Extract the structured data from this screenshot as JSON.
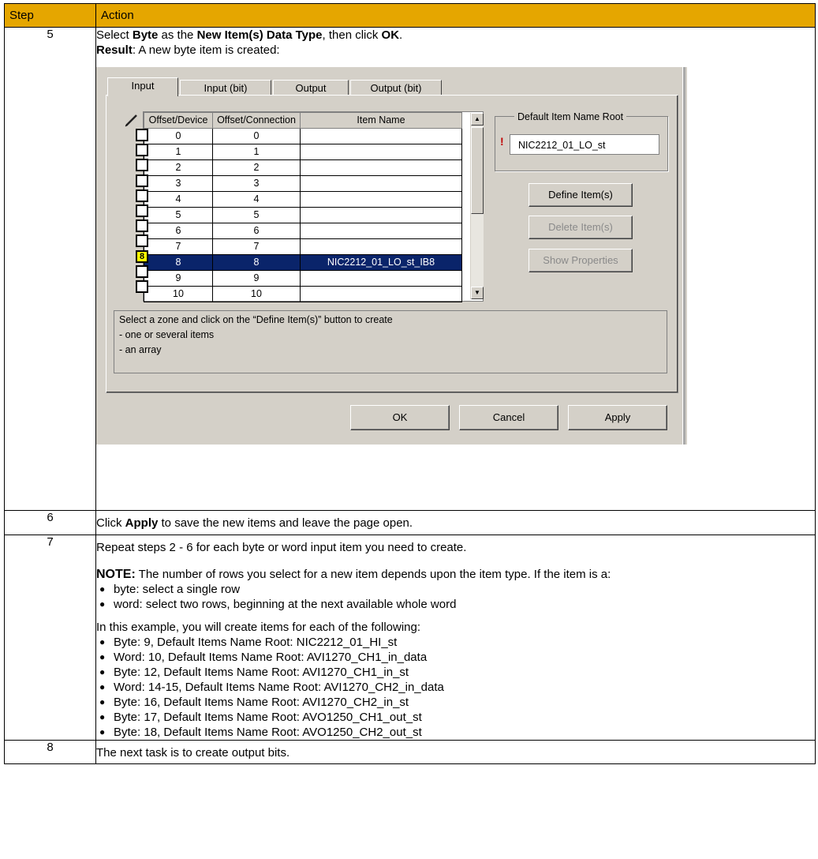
{
  "table": {
    "header_step": "Step",
    "header_action": "Action"
  },
  "step5": {
    "number": "5",
    "line1_pre": "Select ",
    "line1_b1": "Byte",
    "line1_mid1": " as the ",
    "line1_b2": "New Item(s) Data Type",
    "line1_mid2": ", then click ",
    "line1_b3": "OK",
    "line1_end": ".",
    "line2_b": "Result",
    "line2_rest": ": A new byte item is created:"
  },
  "dialog": {
    "tabs": [
      "Input",
      "Input (bit)",
      "Output",
      "Output (bit)"
    ],
    "columns": [
      "Offset/Device",
      "Offset/Connection",
      "Item Name"
    ],
    "rows": [
      {
        "device": "0",
        "connection": "0",
        "item": ""
      },
      {
        "device": "1",
        "connection": "1",
        "item": ""
      },
      {
        "device": "2",
        "connection": "2",
        "item": ""
      },
      {
        "device": "3",
        "connection": "3",
        "item": ""
      },
      {
        "device": "4",
        "connection": "4",
        "item": ""
      },
      {
        "device": "5",
        "connection": "5",
        "item": ""
      },
      {
        "device": "6",
        "connection": "6",
        "item": ""
      },
      {
        "device": "7",
        "connection": "7",
        "item": ""
      },
      {
        "device": "8",
        "connection": "8",
        "item": "NIC2212_01_LO_st_IB8"
      },
      {
        "device": "9",
        "connection": "9",
        "item": ""
      },
      {
        "device": "10",
        "connection": "10",
        "item": ""
      }
    ],
    "selected_marker": "8",
    "group_title": "Default Item Name Root",
    "name_root_value": "NIC2212_01_LO_st",
    "define_button": "Define Item(s)",
    "delete_button": "Delete Item(s)",
    "properties_button": "Show Properties",
    "info_lines": [
      "Select a zone and click on the “Define Item(s)” button to create",
      "- one or several items",
      "- an array"
    ],
    "ok_button": "OK",
    "cancel_button": "Cancel",
    "apply_button": "Apply"
  },
  "step6": {
    "number": "6",
    "pre": "Click ",
    "bold": "Apply",
    "post": " to save the new items and leave the page open."
  },
  "step7": {
    "number": "7",
    "line1": "Repeat steps 2 - 6 for each byte or word input item you need to create.",
    "note_label": "NOTE:",
    "note_text": " The number of rows you select for a new item depends upon the item type. If the item is a:",
    "note_bullets": [
      "byte: select a single row",
      "word: select two rows, beginning at the next available whole word"
    ],
    "example_intro": "In this example, you will create items for each of the following:",
    "example_bullets": [
      "Byte: 9, Default Items Name Root: NIC2212_01_HI_st",
      "Word: 10, Default Items Name Root: AVI1270_CH1_in_data",
      "Byte: 12, Default Items Name Root: AVI1270_CH1_in_st",
      "Word: 14-15, Default Items Name Root: AVI1270_CH2_in_data",
      "Byte: 16, Default Items Name Root: AVI1270_CH2_in_st",
      "Byte: 17, Default Items Name Root: AVO1250_CH1_out_st",
      "Byte: 18, Default Items Name Root: AVO1250_CH2_out_st"
    ]
  },
  "step8": {
    "number": "8",
    "text": "The next task is to create output bits."
  }
}
